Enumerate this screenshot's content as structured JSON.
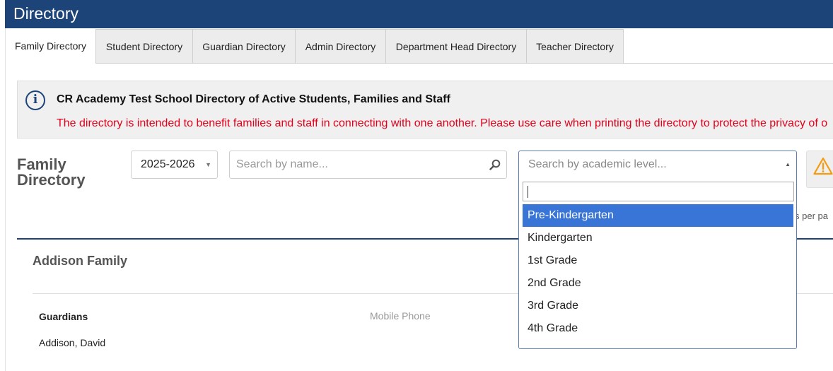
{
  "header": {
    "title": "Directory"
  },
  "tabs": [
    {
      "label": "Family Directory"
    },
    {
      "label": "Student Directory"
    },
    {
      "label": "Guardian Directory"
    },
    {
      "label": "Admin Directory"
    },
    {
      "label": "Department Head Directory"
    },
    {
      "label": "Teacher Directory"
    }
  ],
  "active_tab": "Family Directory",
  "notice": {
    "heading": "CR Academy Test School Directory of Active Students, Families and Staff",
    "message": "The directory is intended to benefit families and staff in connecting with one another. Please use care when printing the directory to protect the privacy of o",
    "icon": "info-icon"
  },
  "filters": {
    "title": "Family Directory",
    "year": "2025-2026",
    "name_search_placeholder": "Search by name...",
    "level_placeholder": "Search by academic level...",
    "level_options": [
      "Pre-Kindergarten",
      "Kindergarten",
      "1st Grade",
      "2nd Grade",
      "3rd Grade",
      "4th Grade"
    ],
    "highlighted_option": "Pre-Kindergarten",
    "per_page_text": "s per pa"
  },
  "colors": {
    "header_bg": "#1d4479",
    "notice_text": "#e3001b",
    "highlight": "#3875d7",
    "warning": "#f39c12"
  },
  "family": {
    "name": "Addison Family",
    "guardians_label": "Guardians",
    "mobile_label": "Mobile Phone",
    "guardian_name": "Addison, David"
  }
}
